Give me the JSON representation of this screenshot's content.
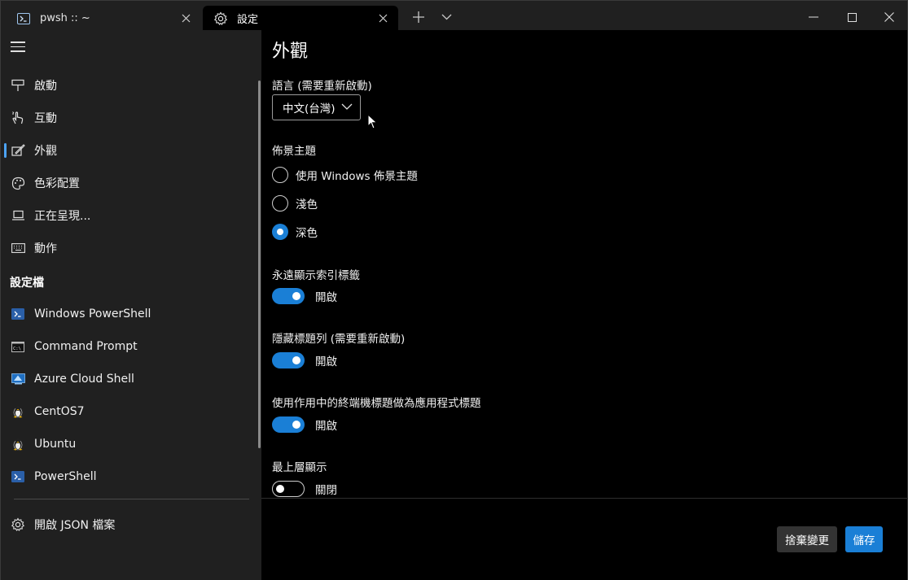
{
  "tabs": [
    {
      "title": "pwsh :: ~",
      "icon": "powershell-icon"
    },
    {
      "title": "設定",
      "icon": "gear-icon"
    }
  ],
  "sidebar": {
    "nav": [
      {
        "label": "啟動",
        "icon": "startup-icon"
      },
      {
        "label": "互動",
        "icon": "interaction-icon"
      },
      {
        "label": "外觀",
        "icon": "appearance-icon",
        "selected": true
      },
      {
        "label": "色彩配置",
        "icon": "palette-icon"
      },
      {
        "label": "正在呈現...",
        "icon": "rendering-icon"
      },
      {
        "label": "動作",
        "icon": "keyboard-icon"
      }
    ],
    "profiles_header": "設定檔",
    "profiles": [
      {
        "label": "Windows PowerShell",
        "icon": "powershell-icon"
      },
      {
        "label": "Command Prompt",
        "icon": "cmd-icon"
      },
      {
        "label": "Azure Cloud Shell",
        "icon": "azure-icon"
      },
      {
        "label": "CentOS7",
        "icon": "linux-icon"
      },
      {
        "label": "Ubuntu",
        "icon": "linux-icon"
      },
      {
        "label": "PowerShell",
        "icon": "powershell-icon"
      }
    ],
    "open_json": "開啟 JSON 檔案"
  },
  "main": {
    "title": "外觀",
    "language_label": "語言 (需要重新啟動)",
    "language_value": "中文(台灣)",
    "theme_label": "佈景主題",
    "theme_options": [
      "使用 Windows 佈景主題",
      "淺色",
      "深色"
    ],
    "theme_selected": 2,
    "settings": [
      {
        "label": "永遠顯示索引標籤",
        "state": "開啟",
        "on": true
      },
      {
        "label": "隱藏標題列 (需要重新啟動)",
        "state": "開啟",
        "on": true
      },
      {
        "label": "使用作用中的終端機標題做為應用程式標題",
        "state": "開啟",
        "on": true
      },
      {
        "label": "最上層顯示",
        "state": "關閉",
        "on": false
      }
    ],
    "discard_label": "捨棄變更",
    "save_label": "儲存"
  },
  "colors": {
    "accent": "#1a7fd6",
    "sidebar_bg": "#202020",
    "content_bg": "#000000"
  }
}
